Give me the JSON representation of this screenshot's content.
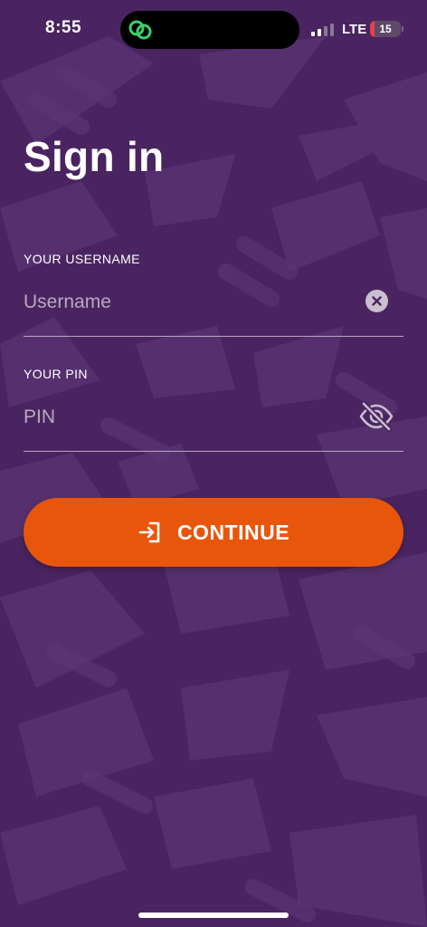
{
  "status_bar": {
    "time": "8:55",
    "network": "LTE",
    "battery_level": "15",
    "battery_fraction": 0.15,
    "signal_bars_active": 2,
    "signal_bars_total": 4,
    "island_icon": "link-rings-icon"
  },
  "page": {
    "title": "Sign in"
  },
  "form": {
    "username_label": "YOUR USERNAME",
    "username_placeholder": "Username",
    "username_value": "",
    "username_clear_icon": "clear-circle-icon",
    "pin_label": "YOUR PIN",
    "pin_placeholder": "PIN",
    "pin_value": "",
    "pin_visibility_icon": "eye-slash-icon",
    "continue_label": "CONTINUE",
    "continue_icon": "login-arrow-icon"
  },
  "colors": {
    "background": "#4a2460",
    "pattern": "#5b3473",
    "accent": "#e8560b",
    "text": "#ffffff",
    "placeholder": "#b8a8c2",
    "battery_low": "#e8414a",
    "island_green": "#3ad16b"
  }
}
